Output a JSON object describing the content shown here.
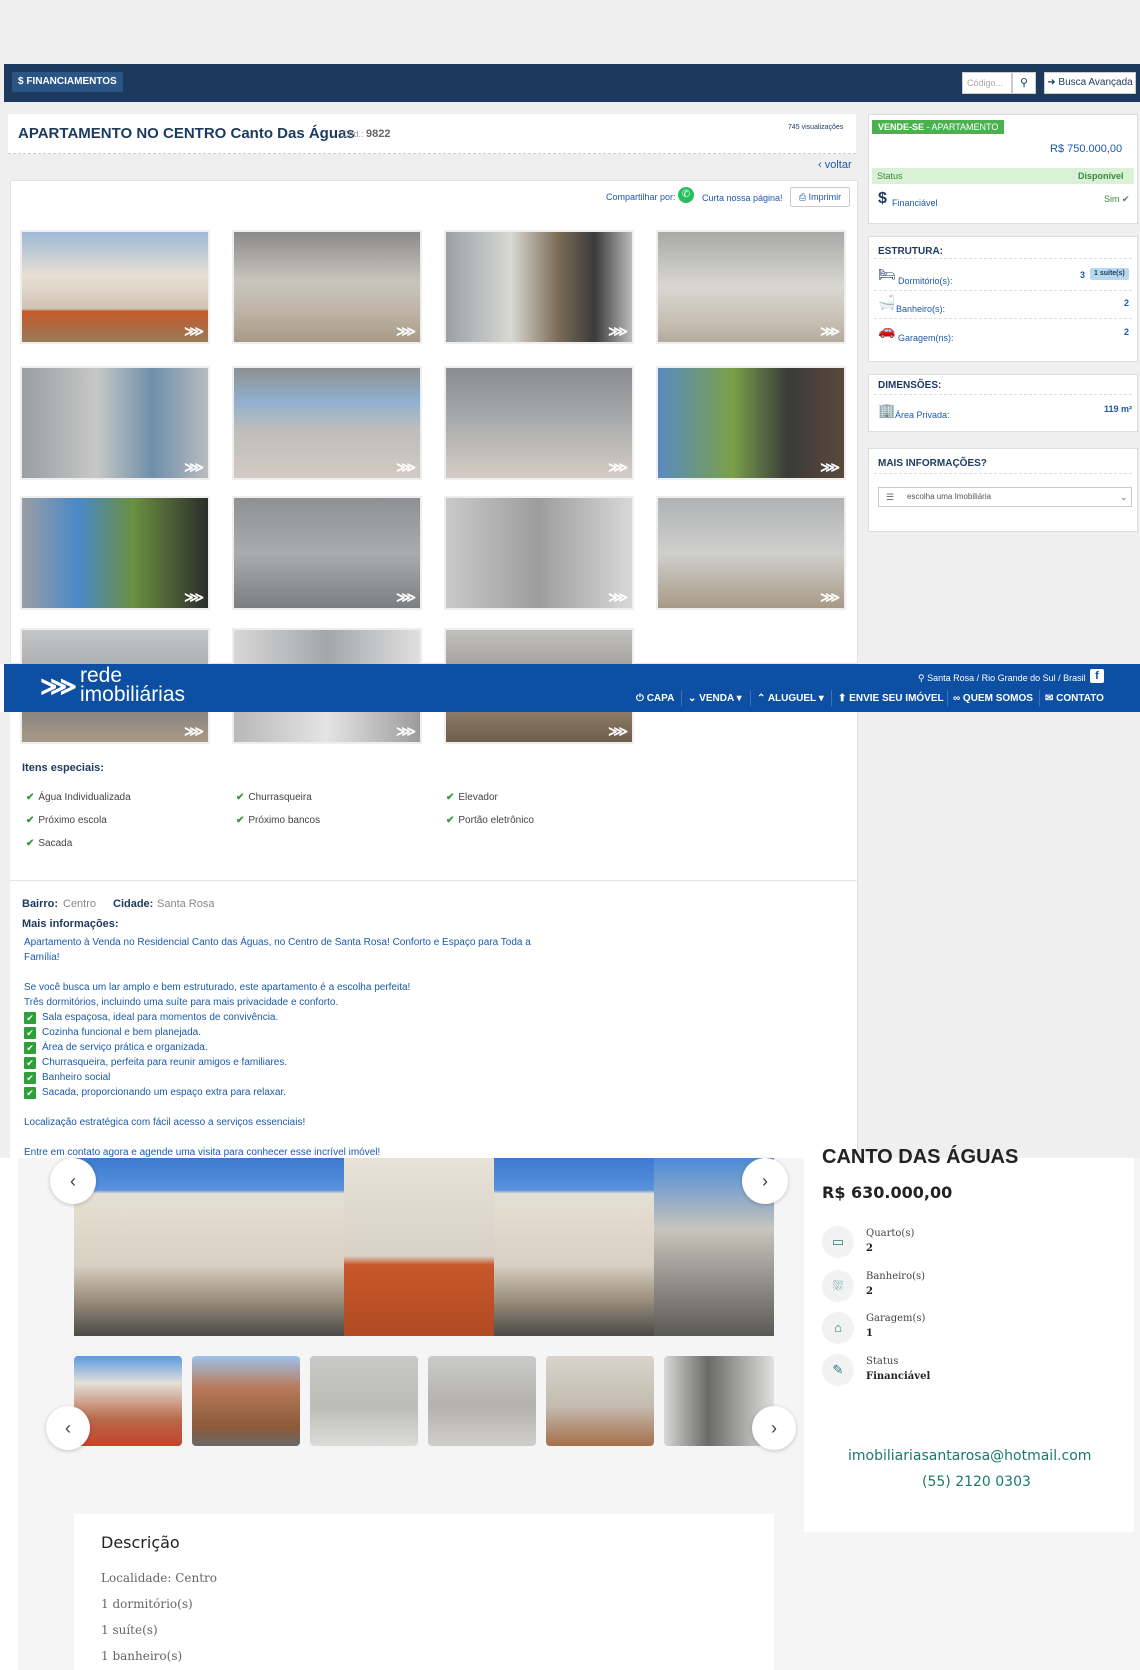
{
  "topbar": {
    "financiamentos": "$ FINANCIAMENTOS",
    "codigo_placeholder": "Código...",
    "busca_avancada": "➜ Busca Avançada"
  },
  "listing1": {
    "title": "APARTAMENTO NO CENTRO Canto Das Águas",
    "cod_label": "Cód.:",
    "cod_value": "9822",
    "views": "745 visualizações",
    "voltar": "voltar",
    "share_label": "Compartilhar por:",
    "curta": "Curta nossa página!",
    "imprimir": "Imprimir"
  },
  "sidebar": {
    "badge_strong": "VENDE-SE",
    "badge_rest": " - APARTAMENTO",
    "price": "R$ 750.000,00",
    "status_label": "Status",
    "status_value": "Disponível",
    "financiavel_label": "Financiável",
    "financiavel_value": "Sim ✔",
    "estrutura_h": "ESTRUTURA:",
    "dormitorios_label": "Dormitório(s):",
    "dormitorios_value": "3",
    "suite_badge": "1 suíte(s)",
    "banheiro_label": "Banheiro(s):",
    "banheiro_value": "2",
    "garagem_label": "Garagem(ns):",
    "garagem_value": "2",
    "dimensoes_h": "DIMENSÕES:",
    "area_label": "Área Privada:",
    "area_value": "119 m²",
    "mais_h": "MAIS INFORMAÇÕES?",
    "select_value": "escolha uma Imobiliária"
  },
  "header": {
    "logo_line1": "rede",
    "logo_line2": "imobiliárias",
    "location": "Santa Rosa / Rio Grande do Sul / Brasil",
    "fb": "f",
    "nav": [
      "CAPA",
      "VENDA ▾",
      "ALUGUEL ▾",
      "ENVIE SEU IMÓVEL",
      "QUEM SOMOS",
      "CONTATO"
    ],
    "nav_icons": [
      "⏻",
      "⌄",
      "⌃",
      "⬆",
      "🔗",
      "✉"
    ]
  },
  "itens": {
    "heading": "Itens especiais:",
    "items": [
      "Água Individualizada",
      "Churrasqueira",
      "Elevador",
      "Próximo escola",
      "Próximo bancos",
      "Portão eletrônico",
      "Sacada"
    ]
  },
  "details": {
    "bairro_label": "Bairro:",
    "bairro_value": "Centro",
    "cidade_label": "Cidade:",
    "cidade_value": "Santa Rosa",
    "mais_heading": "Mais informações:",
    "intro1": "Apartamento à Venda no Residencial Canto das Águas, no Centro de Santa Rosa! Conforto e Espaço para Toda a",
    "intro2": "Família!",
    "p1": "Se você busca um lar amplo e bem estruturado, este apartamento é a escolha perfeita!",
    "p2": "Três dormitórios, incluindo uma suíte para mais privacidade e conforto.",
    "checks": [
      "Sala espaçosa, ideal para momentos de convivência.",
      "Cozinha funcional e bem planejada.",
      "Área de serviço prática e organizada.",
      "Churrasqueira, perfeita para reunir amigos e familiares.",
      "Banheiro social",
      "Sacada, proporcionando um espaço extra para relaxar."
    ],
    "p3": "Localização estratégica com fácil acesso a serviços essenciais!",
    "p4": "Entre em contato agora e agende uma visita para conhecer esse incrível imóvel!"
  },
  "listing2": {
    "title_cut": "CANTO DAS ÁGUAS",
    "price": "R$ 630.000,00",
    "quarto_label": "Quarto(s)",
    "quarto_value": "2",
    "banheiro_label": "Banheiro(s)",
    "banheiro_value": "2",
    "garagem_label": "Garagem(s)",
    "garagem_value": "1",
    "status_label": "Status",
    "status_value": "Financiável",
    "email": "imobiliariasantarosa@hotmail.com",
    "phone": "(55) 2120 0303",
    "desc_heading": "Descrição",
    "desc_items": [
      "Localidade: Centro",
      "1 dormitório(s)",
      "1 suíte(s)",
      "1 banheiro(s)"
    ]
  }
}
